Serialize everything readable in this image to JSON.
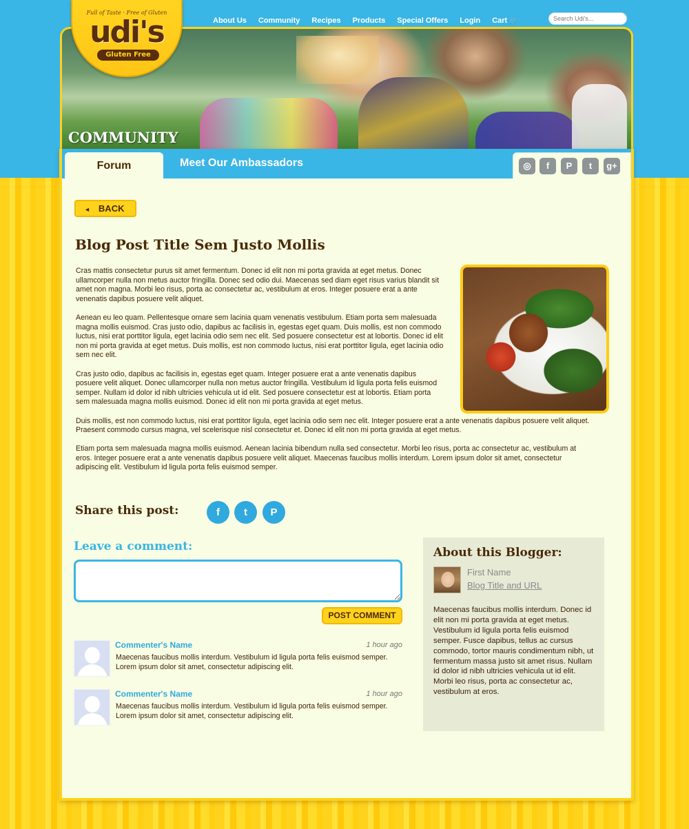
{
  "nav": {
    "items": [
      "About Us",
      "Community",
      "Recipes",
      "Products",
      "Special Offers",
      "Login",
      "Cart"
    ],
    "search_placeholder": "Search Udi's..."
  },
  "logo": {
    "tagline": "Full of Taste · Free of Gluten",
    "brand": "udi's",
    "sub": "Gluten Free"
  },
  "hero": {
    "title": "COMMUNITY"
  },
  "tabs": {
    "forum": "Forum",
    "ambassadors": "Meet Our Ambassadors"
  },
  "social_header": [
    "instagram",
    "facebook",
    "pinterest",
    "twitter",
    "google-plus"
  ],
  "back_label": "BACK",
  "post": {
    "title": "Blog Post Title Sem Justo Mollis",
    "paragraphs": [
      "Cras mattis consectetur purus sit amet fermentum. Donec id elit non mi porta gravida at eget metus. Donec ullamcorper nulla non metus auctor fringilla. Donec sed odio dui. Maecenas sed diam eget risus varius blandit sit amet non magna. Morbi leo risus, porta ac consectetur ac, vestibulum at eros. Integer posuere erat a ante venenatis dapibus posuere velit aliquet.",
      "Aenean eu leo quam. Pellentesque ornare sem lacinia quam venenatis vestibulum. Etiam porta sem malesuada magna mollis euismod. Cras justo odio, dapibus ac facilisis in, egestas eget quam. Duis mollis, est non commodo luctus, nisi erat porttitor ligula, eget lacinia odio sem nec elit. Sed posuere consectetur est at lobortis. Donec id elit non mi porta gravida at eget metus. Duis mollis, est non commodo luctus, nisi erat porttitor ligula, eget lacinia odio sem nec elit.",
      "Cras justo odio, dapibus ac facilisis in, egestas eget quam. Integer posuere erat a ante venenatis dapibus posuere velit aliquet. Donec ullamcorper nulla non metus auctor fringilla. Vestibulum id ligula porta felis euismod semper. Nullam id dolor id nibh ultricies vehicula ut id elit. Sed posuere consectetur est at lobortis. Etiam porta sem malesuada magna mollis euismod. Donec id elit non mi porta gravida at eget metus.",
      "Duis mollis, est non commodo luctus, nisi erat porttitor ligula, eget lacinia odio sem nec elit. Integer posuere erat a ante venenatis dapibus posuere velit aliquet. Praesent commodo cursus magna, vel scelerisque nisl consectetur et. Donec id elit non mi porta gravida at eget metus.",
      "Etiam porta sem malesuada magna mollis euismod. Aenean lacinia bibendum nulla sed consectetur. Morbi leo risus, porta ac consectetur ac, vestibulum at eros. Integer posuere erat a ante venenatis dapibus posuere velit aliquet. Maecenas faucibus mollis interdum. Lorem ipsum dolor sit amet, consectetur adipiscing elit. Vestibulum id ligula porta felis euismod semper."
    ]
  },
  "share": {
    "label": "Share this post:",
    "icons": [
      "facebook",
      "twitter",
      "pinterest"
    ]
  },
  "comment_form": {
    "heading": "Leave a comment:",
    "input_value": "",
    "button": "POST COMMENT"
  },
  "comments": [
    {
      "name": "Commenter's Name",
      "time": "1 hour ago",
      "text": "Maecenas faucibus mollis interdum. Vestibulum id ligula porta felis euismod semper. Lorem ipsum dolor sit amet, consectetur adipiscing elit."
    },
    {
      "name": "Commenter's Name",
      "time": "1 hour ago",
      "text": "Maecenas faucibus mollis interdum. Vestibulum id ligula porta felis euismod semper. Lorem ipsum dolor sit amet, consectetur adipiscing elit."
    }
  ],
  "blogger": {
    "heading": "About this Blogger:",
    "name": "First Name",
    "link": "Blog Title and URL",
    "bio": "Maecenas faucibus mollis interdum. Donec id elit non mi porta gravida at eget metus. Vestibulum id ligula porta felis euismod semper. Fusce dapibus, tellus ac cursus commodo, tortor mauris condimentum nibh, ut fermentum massa justo sit amet risus. Nullam id dolor id nibh ultricies vehicula ut id elit. Morbi leo risus, porta ac consectetur ac, vestibulum at eros."
  },
  "colors": {
    "accent_blue": "#39b5e6",
    "brand_yellow": "#ffd21c",
    "text_brown": "#4a2a07",
    "panel_bg": "#f8fde3"
  }
}
